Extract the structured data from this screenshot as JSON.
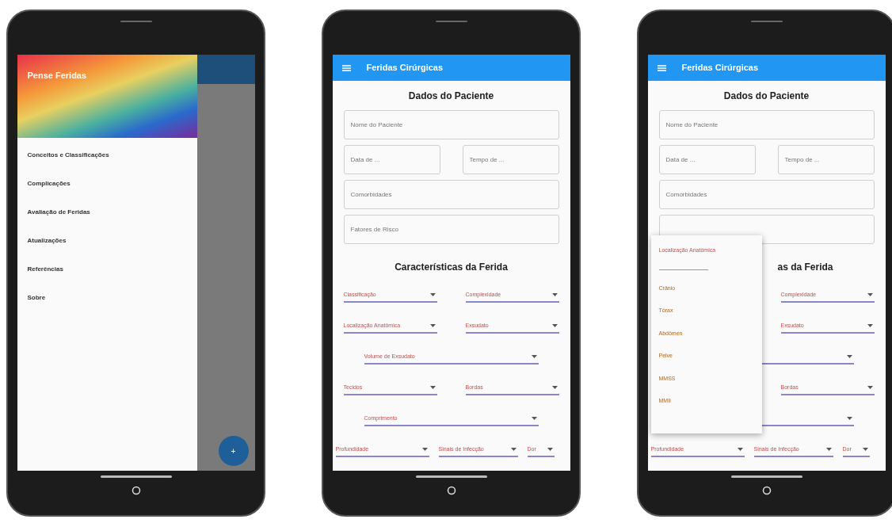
{
  "phones": [
    {
      "kind": "drawer",
      "drawer": {
        "title": "Pense Feridas",
        "items": [
          "Conceitos e Classificações",
          "Complicações",
          "Avaliação de Feridas",
          "Atualizações",
          "Referências",
          "Sobre"
        ]
      },
      "fab": "+"
    },
    {
      "kind": "form",
      "app_bar": {
        "title": "Feridas Cirúrgicas"
      },
      "patient": {
        "heading": {
          "text": "Dados do Paciente"
        },
        "fields": [
          [
            {
              "placeholder": "Nome do Paciente"
            }
          ],
          [
            {
              "placeholder": "Data de ..."
            },
            {
              "placeholder": "Tempo de ..."
            }
          ],
          [
            {
              "placeholder": "Comorbidades"
            }
          ],
          [
            {
              "placeholder": "Fatores de Risco"
            }
          ]
        ]
      },
      "wound": {
        "heading": {
          "text": "Características da Ferida",
          "cut": false
        },
        "rows": [
          [
            {
              "label": "Classificação"
            },
            {
              "label": "Complexidade"
            }
          ],
          [
            {
              "label": "Localização Anatômica"
            },
            {
              "label": "Exsudato"
            }
          ],
          [
            {
              "label": "Volume de Exsudato"
            }
          ],
          [
            {
              "label": "Tecidos"
            },
            {
              "label": "Bordas"
            }
          ],
          [
            {
              "label": "Comprimento"
            }
          ],
          [
            {
              "label": "Profundidade"
            },
            {
              "label": "Sinais de Infecção"
            },
            {
              "label": "Dor"
            }
          ]
        ]
      }
    },
    {
      "kind": "form",
      "app_bar": {
        "title": "Feridas Cirúrgicas"
      },
      "patient": {
        "heading": {
          "text": "Dados do Paciente"
        },
        "fields": [
          [
            {
              "placeholder": "Nome do Paciente"
            }
          ],
          [
            {
              "placeholder": "Data de ..."
            },
            {
              "placeholder": "Tempo de ..."
            }
          ],
          [
            {
              "placeholder": "Comorbidades"
            }
          ],
          [
            {
              "covered": true
            }
          ]
        ]
      },
      "wound": {
        "heading": {
          "text": "as da Ferida",
          "cut": true
        },
        "rows": [
          [
            null,
            {
              "label": "Complexidade"
            }
          ],
          [
            null,
            {
              "label": "Exsudato"
            }
          ],
          [
            {
              "covered": true
            }
          ],
          [
            null,
            {
              "label": "Bordas"
            }
          ],
          [
            {
              "covered": true
            }
          ],
          [
            {
              "label": "Profundidade"
            },
            {
              "label": "Sinais de Infecção"
            },
            {
              "label": "Dor"
            }
          ]
        ]
      },
      "menu": {
        "title": "Localização Anatômica",
        "items": [
          "Crânio",
          "Tórax",
          "Abdômen",
          "Pelve",
          "MMSS",
          "MMII"
        ]
      }
    }
  ]
}
